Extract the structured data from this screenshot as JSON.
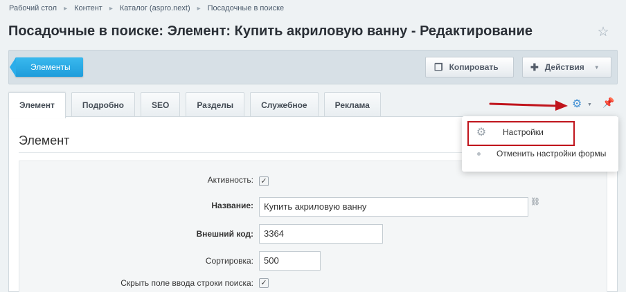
{
  "breadcrumb": {
    "items": [
      "Рабочий стол",
      "Контент",
      "Каталог (aspro.next)",
      "Посадочные в поиске"
    ],
    "separator": "▸"
  },
  "page": {
    "title": "Посадочные в поиске: Элемент: Купить акриловую ванну - Редактирование",
    "favorite_icon": "star-icon"
  },
  "toolbar": {
    "back_label": "Элементы",
    "copy_label": "Копировать",
    "actions_label": "Действия"
  },
  "tabs": [
    "Элемент",
    "Подробно",
    "SEO",
    "Разделы",
    "Служебное",
    "Реклама"
  ],
  "settings_menu": {
    "items": [
      {
        "label": "Настройки",
        "icon": "gear-icon"
      },
      {
        "label": "Отменить настройки формы",
        "icon": "dot-icon"
      }
    ]
  },
  "form": {
    "section_title": "Элемент",
    "fields": {
      "active": {
        "label": "Активность:",
        "checked": true
      },
      "name": {
        "label": "Название:",
        "value": "Купить акриловую ванну"
      },
      "external_code": {
        "label": "Внешний код:",
        "value": "3364"
      },
      "sort": {
        "label": "Сортировка:",
        "value": "500"
      },
      "hide_search": {
        "label": "Скрыть поле ввода строки поиска:",
        "checked": true
      }
    }
  },
  "colors": {
    "accent_blue": "#2cadea",
    "annotation_red": "#c0141c",
    "gear_blue": "#3f8fd4"
  }
}
